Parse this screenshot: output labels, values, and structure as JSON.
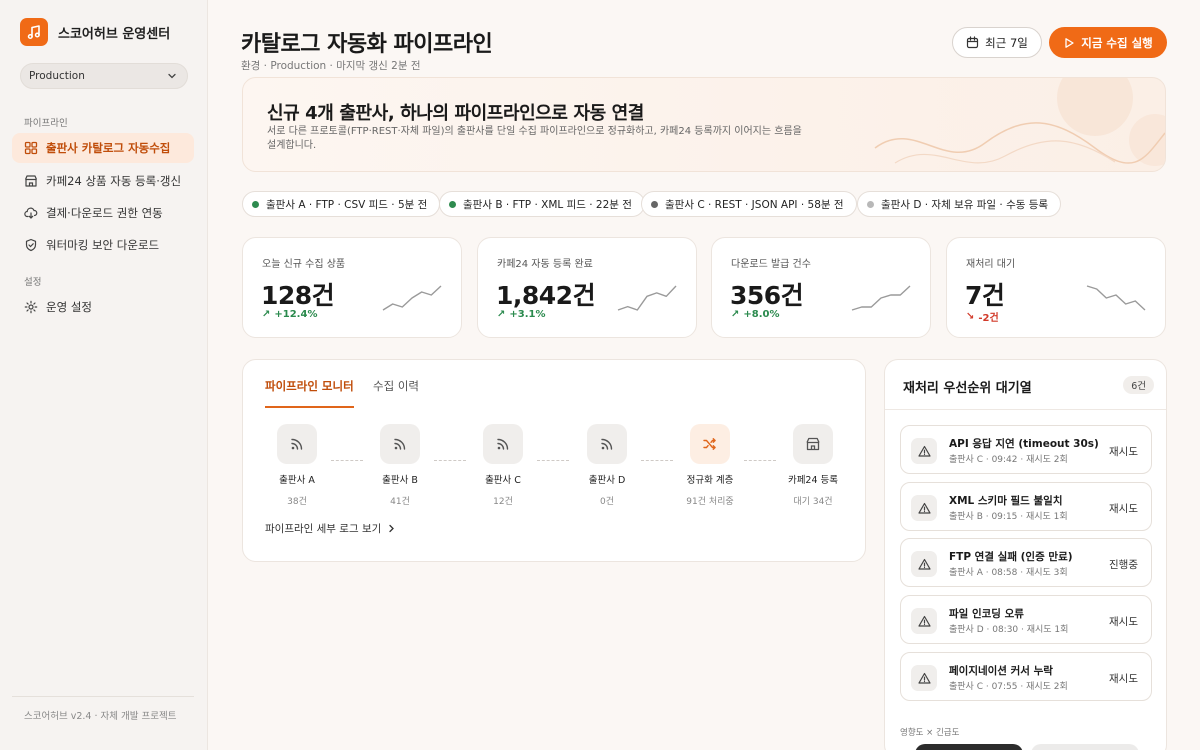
{
  "brand": {
    "name": "스코어허브 운영센터"
  },
  "env_select": {
    "value": "Production"
  },
  "sidebar": {
    "section_pipeline": "파이프라인",
    "items": [
      {
        "label": "출판사 카탈로그 자동수집"
      },
      {
        "label": "카페24 상품 자동 등록·갱신"
      },
      {
        "label": "결제·다운로드 권한 연동"
      },
      {
        "label": "워터마킹 보안 다운로드"
      }
    ],
    "section_settings": "설정",
    "settings_label": "운영 설정",
    "footer": "스코어허브 v2.4 · 자체 개발 프로젝트"
  },
  "header": {
    "title": "카탈로그 자동화 파이프라인",
    "subtitle": "환경 · Production · 마지막 갱신 2분 전",
    "range_label": "최근 7일",
    "run_label": "지금 수집 실행"
  },
  "hero": {
    "title": "신규 4개 출판사, 하나의 파이프라인으로 자동 연결",
    "desc": "서로 다른 프로토콜(FTP·REST·자체 파일)의 출판사를 단일 수집 파이프라인으로 정규화하고, 카페24 등록까지 이어지는 흐름을 설계합니다."
  },
  "sources": [
    {
      "label": "출판사 A · FTP · CSV 피드 · 5분 전",
      "color": "#2e8b4f"
    },
    {
      "label": "출판사 B · FTP · XML 피드 · 22분 전",
      "color": "#2e8b4f"
    },
    {
      "label": "출판사 C · REST · JSON API · 58분 전",
      "color": "#666666"
    },
    {
      "label": "출판사 D · 자체 보유 파일 · 수동 등록",
      "color": "#b8b8b8"
    }
  ],
  "kpis": [
    {
      "label": "오늘 신규 수집 상품",
      "value": "128건",
      "delta": "+12.4%",
      "trend": "up",
      "spark": [
        2,
        4,
        3,
        6,
        8,
        7,
        10
      ]
    },
    {
      "label": "카페24 자동 등록 완료",
      "value": "1,842건",
      "delta": "+3.1%",
      "trend": "up",
      "spark": [
        3,
        4,
        3,
        7,
        8,
        7,
        10
      ]
    },
    {
      "label": "다운로드 발급 건수",
      "value": "356건",
      "delta": "+8.0%",
      "trend": "up",
      "spark": [
        2,
        3,
        3,
        6,
        7,
        7,
        10
      ]
    },
    {
      "label": "재처리 대기",
      "value": "7건",
      "delta": "-2건",
      "trend": "down",
      "spark": [
        9,
        8,
        5,
        6,
        3,
        4,
        1
      ]
    }
  ],
  "pipeline": {
    "tabs": [
      "파이프라인 모니터",
      "수집 이력"
    ],
    "nodes": [
      {
        "name": "출판사 A",
        "sub": "38건",
        "icon": "rss-icon"
      },
      {
        "name": "출판사 B",
        "sub": "41건",
        "icon": "rss-icon"
      },
      {
        "name": "출판사 C",
        "sub": "12건",
        "icon": "rss-icon"
      },
      {
        "name": "출판사 D",
        "sub": "0건",
        "icon": "rss-icon"
      },
      {
        "name": "정규화 계층",
        "sub": "91건 처리중",
        "icon": "shuffle-icon"
      },
      {
        "name": "카페24 등록",
        "sub": "대기 34건",
        "icon": "store-icon"
      }
    ],
    "log_link": "파이프라인 세부 로그 보기"
  },
  "queue": {
    "title": "재처리 우선순위 대기열",
    "count": "6건",
    "items": [
      {
        "title": "API 응답 지연 (timeout 30s)",
        "meta": "출판사 C · 09:42 · 재시도 2회",
        "action": "재시도"
      },
      {
        "title": "XML 스키마 필드 불일치",
        "meta": "출판사 B · 09:15 · 재시도 1회",
        "action": "재시도"
      },
      {
        "title": "FTP 연결 실패 (인증 만료)",
        "meta": "출판사 A · 08:58 · 재시도 3회",
        "action": "진행중"
      },
      {
        "title": "파일 인코딩 오류",
        "meta": "출판사 D · 08:30 · 재시도 1회",
        "action": "재시도"
      },
      {
        "title": "페이지네이션 커서 누락",
        "meta": "출판사 C · 07:55 · 재시도 2회",
        "action": "재시도"
      }
    ],
    "footer_label": "영향도 × 긴급도"
  },
  "colors": {
    "accent": "#f06a16",
    "up": "#2a8a4d",
    "down": "#d23a2a"
  }
}
